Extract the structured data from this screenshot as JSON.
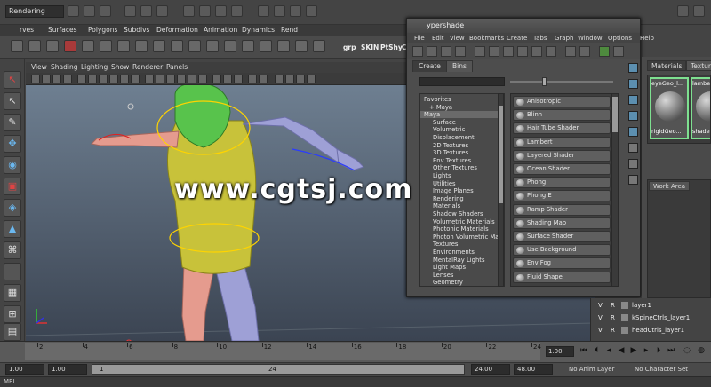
{
  "toolbar": {
    "mode": "Rendering"
  },
  "shelf": {
    "tabs": [
      "rves",
      "Surfaces",
      "Polygons",
      "Subdivs",
      "Deformation",
      "Animation",
      "Dynamics",
      "Rend"
    ],
    "labels": [
      "grp",
      "SKIN",
      "PtShy",
      "Ccl"
    ]
  },
  "viewport": {
    "menu": [
      "View",
      "Shading",
      "Lighting",
      "Show",
      "Renderer",
      "Panels"
    ]
  },
  "hypershade": {
    "title": "ypershade",
    "menu": [
      "File",
      "Edit",
      "View",
      "Bookmarks",
      "Create",
      "Tabs",
      "Graph",
      "Window",
      "Options",
      "Help"
    ],
    "tabs": [
      "Create",
      "Bins"
    ],
    "tree": [
      "Favorites",
      "+ Maya",
      "Maya",
      "Surface",
      "Volumetric",
      "Displacement",
      "2D Textures",
      "3D Textures",
      "Env Textures",
      "Other Textures",
      "Lights",
      "Utilities",
      "Image Planes",
      "Rendering",
      "Materials",
      "Shadow Shaders",
      "Volumetric Materials",
      "Photonic Materials",
      "Photon Volumetric Ma...",
      "Textures",
      "Environments",
      "MentalRay Lights",
      "Light Maps",
      "Lenses",
      "Geometry"
    ],
    "nodes": [
      "Anisotropic",
      "Blinn",
      "Hair Tube Shader",
      "Lambert",
      "Layered Shader",
      "Ocean Shader",
      "Phong",
      "Phong E",
      "Ramp Shader",
      "Shading Map",
      "Surface Shader",
      "Use Background",
      "Env Fog",
      "Fluid Shape"
    ]
  },
  "right_panel": {
    "tabs": [
      "Materials",
      "Texture"
    ],
    "swatches": [
      {
        "top": "eyeGeo_l...",
        "bottom": "rigidGeo..."
      },
      {
        "top": "lamber",
        "bottom": "shade"
      }
    ],
    "work_area": "Work Area"
  },
  "layers": [
    {
      "v": "V",
      "r": "R",
      "name": "layer1"
    },
    {
      "v": "V",
      "r": "R",
      "name": "kSpineCtrls_layer1"
    },
    {
      "v": "V",
      "r": "R",
      "name": "headCtrls_layer1"
    }
  ],
  "timeline": {
    "ticks": [
      "2",
      "4",
      "6",
      "8",
      "10",
      "12",
      "14",
      "16",
      "18",
      "20",
      "22",
      "24"
    ],
    "current": "1.00"
  },
  "range": {
    "start": "1.00",
    "inner_start": "1.00",
    "slider_start": "1",
    "slider_end": "24",
    "end": "24.00",
    "outer_end": "48.00",
    "anim_layer": "No Anim Layer",
    "char_set": "No Character Set"
  },
  "command": {
    "label": "MEL"
  },
  "watermark": "www.cgtsj.com",
  "colors": {
    "character_skin": "#e59b8e",
    "character_vest": "#c8c23a",
    "character_head": "#58c34c",
    "character_limbs": "#9ea0d6"
  }
}
